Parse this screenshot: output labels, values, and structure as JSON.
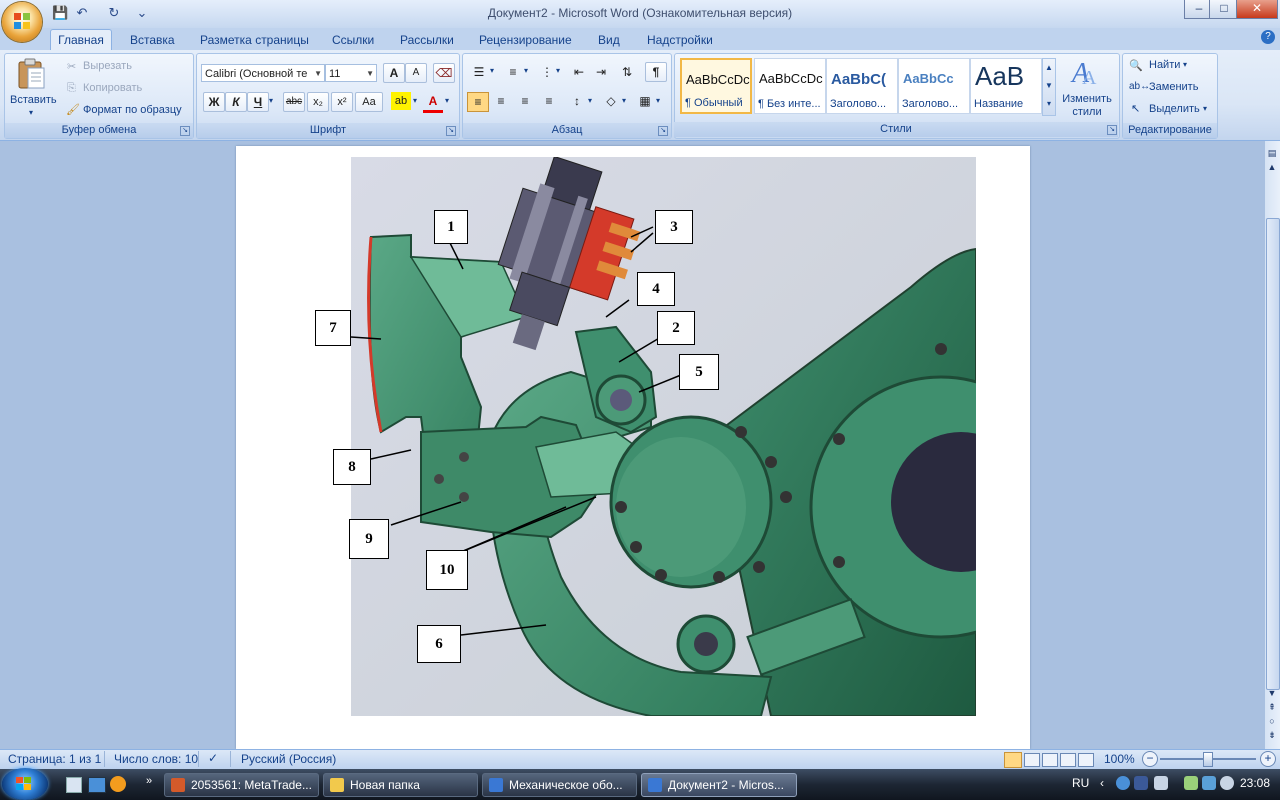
{
  "window": {
    "title": "Документ2 - Microsoft Word (Ознакомительная версия)",
    "controls": {
      "minimize": "–",
      "maximize": "□",
      "close": "✕"
    }
  },
  "qat": {
    "save": "💾",
    "undo": "↶",
    "redo": "↻",
    "customize": "⌄"
  },
  "tabs": [
    {
      "label": "Главная"
    },
    {
      "label": "Вставка"
    },
    {
      "label": "Разметка страницы"
    },
    {
      "label": "Ссылки"
    },
    {
      "label": "Рассылки"
    },
    {
      "label": "Рецензирование"
    },
    {
      "label": "Вид"
    },
    {
      "label": "Надстройки"
    }
  ],
  "ribbon": {
    "clipboard": {
      "label": "Буфер обмена",
      "paste": "Вставить",
      "cut": "Вырезать",
      "copy": "Копировать",
      "format_painter": "Формат по образцу"
    },
    "font": {
      "label": "Шрифт",
      "font_name": "Calibri (Основной те",
      "font_size": "11",
      "grow": "A",
      "shrink": "A",
      "bold": "Ж",
      "italic": "К",
      "underline": "Ч",
      "strike": "abc",
      "subscript": "x₂",
      "superscript": "x²",
      "case": "Aa"
    },
    "paragraph": {
      "label": "Абзац",
      "pilcrow": "¶"
    },
    "styles": {
      "label": "Стили",
      "items": [
        {
          "sample": "AaBbCcDc",
          "name": "¶ Обычный"
        },
        {
          "sample": "AaBbCcDc",
          "name": "¶ Без инте..."
        },
        {
          "sample": "AaBbC(",
          "name": "Заголово..."
        },
        {
          "sample": "AaBbCc",
          "name": "Заголово..."
        },
        {
          "sample": "AaB",
          "name": "Название"
        }
      ],
      "change": "Изменить стили"
    },
    "editing": {
      "label": "Редактирование",
      "find": "Найти",
      "replace": "Заменить",
      "select": "Выделить"
    }
  },
  "figure": {
    "callouts": [
      "1",
      "2",
      "3",
      "4",
      "5",
      "6",
      "7",
      "8",
      "9",
      "10"
    ]
  },
  "statusbar": {
    "page": "Страница: 1 из 1",
    "words": "Число слов: 10",
    "language": "Русский (Россия)",
    "zoom": "100%"
  },
  "taskbar": {
    "tasks": [
      {
        "label": "2053561: MetaTrade..."
      },
      {
        "label": "Новая папка"
      },
      {
        "label": "Механическое обо..."
      },
      {
        "label": "Документ2 - Micros..."
      }
    ],
    "lang": "RU",
    "time": "23:08"
  },
  "colors": {
    "accent": "#15428b",
    "machine_green": "#3f8f6e",
    "pad_red": "#d43a2a"
  }
}
